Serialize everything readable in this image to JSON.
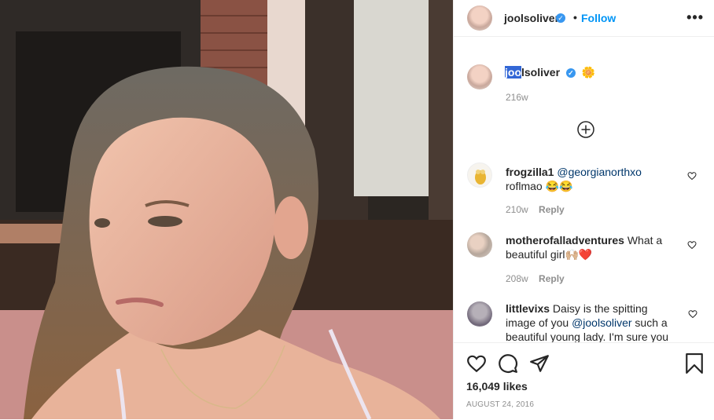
{
  "post": {
    "username": "joolsoliver",
    "follow_label": "Follow",
    "more_icon": "more-horizontal-icon"
  },
  "caption": {
    "username_selected": "joo",
    "username_rest": "lsoliver",
    "emoji": "🌼",
    "time": "216w"
  },
  "load_more_icon": "plus-circle-icon",
  "comments": [
    {
      "username": "frogzilla1",
      "mention": "@georgianorthxo",
      "text_line2": "roflmao 😂😂",
      "time": "210w",
      "reply": "Reply"
    },
    {
      "username": "motherofalladventures",
      "text_line1": "What a",
      "text_line2": "beautiful girl🙌🏼❤️",
      "time": "208w",
      "reply": "Reply"
    },
    {
      "username": "littlevixs",
      "text_line1": "Daisy is the spitting",
      "text_line2a": "image of you ",
      "mention": "@joolsoliver",
      "text_line2b": " such a",
      "text_line3": "beautiful young lady. I'm sure you"
    }
  ],
  "actions": {
    "likes": "16,049 likes",
    "date": "AUGUST 24, 2016",
    "icons": [
      "heart-icon",
      "comment-icon",
      "share-icon",
      "bookmark-icon"
    ]
  },
  "colors": {
    "accent": "#0095f6",
    "verified": "#3897f0",
    "text": "#262626",
    "muted": "#8e8e8e"
  }
}
